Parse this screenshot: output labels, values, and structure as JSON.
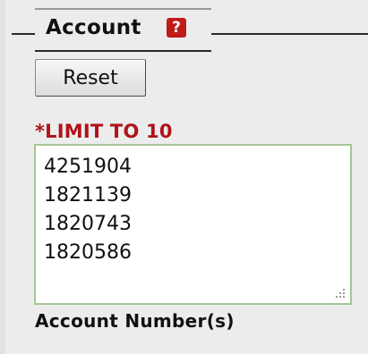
{
  "fieldset": {
    "legend": "Account",
    "help_icon": "question-mark-icon",
    "help_icon_glyph": "?",
    "help_icon_color": "#bf1b1b"
  },
  "reset_button": {
    "label": "Reset"
  },
  "limit_notice": {
    "text": "*LIMIT TO 10",
    "color": "#b0121a"
  },
  "account_numbers": {
    "values": [
      "4251904",
      "1821139",
      "1820743",
      "1820586"
    ],
    "border_color": "#a7c693"
  },
  "field_label": "Account Number(s)"
}
